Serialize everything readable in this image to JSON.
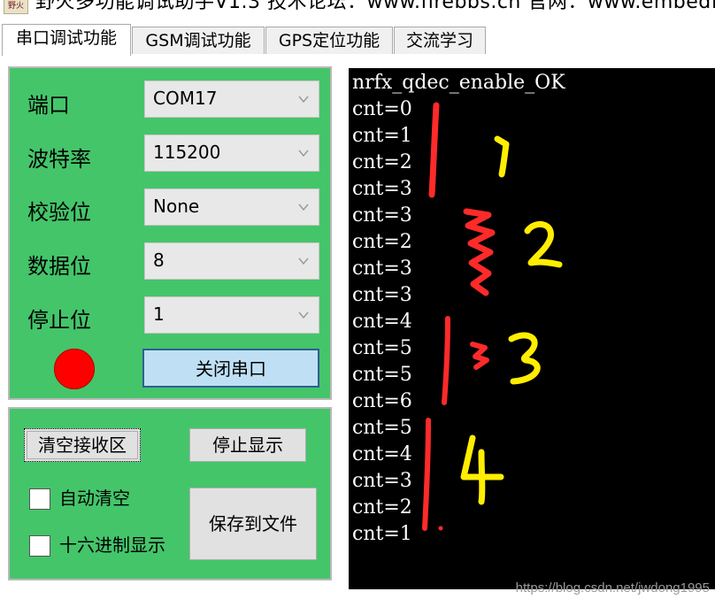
{
  "title_bar": {
    "app_icon_text": "野火",
    "title": "野火多功能调试助手V1.3    技术论坛：www.firebbs.cn   官网：www.embedfire"
  },
  "tabs": [
    {
      "label": "串口调试功能",
      "active": true
    },
    {
      "label": "GSM调试功能",
      "active": false
    },
    {
      "label": "GPS定位功能",
      "active": false
    },
    {
      "label": "交流学习",
      "active": false
    }
  ],
  "serial_settings": {
    "port": {
      "label": "端口",
      "value": "COM17"
    },
    "baud": {
      "label": "波特率",
      "value": "115200"
    },
    "parity": {
      "label": "校验位",
      "value": "None"
    },
    "data_bits": {
      "label": "数据位",
      "value": "8"
    },
    "stop_bits": {
      "label": "停止位",
      "value": "1"
    },
    "status_color": "#ff0000",
    "close_button": "关闭串口"
  },
  "receive_controls": {
    "clear_button": "清空接收区",
    "stop_display_button": "停止显示",
    "auto_clear_label": "自动清空",
    "hex_display_label": "十六进制显示",
    "save_file_button": "保存到文件",
    "auto_clear_checked": false,
    "hex_display_checked": false
  },
  "terminal": {
    "lines": [
      "nrfx_qdec_enable_OK",
      "cnt=0",
      "cnt=1",
      "cnt=2",
      "cnt=3",
      "cnt=3",
      "cnt=2",
      "cnt=3",
      "cnt=3",
      "cnt=4",
      "cnt=5",
      "cnt=5",
      "cnt=6",
      "cnt=5",
      "cnt=4",
      "cnt=3",
      "cnt=2",
      "cnt=1"
    ]
  },
  "annotations": {
    "labels": [
      "1",
      "2",
      "3",
      "4"
    ],
    "red_color": "#ff2a2a",
    "yellow_color": "#ffee00"
  },
  "watermark": "https://blog.csdn.net/jwdong1995"
}
